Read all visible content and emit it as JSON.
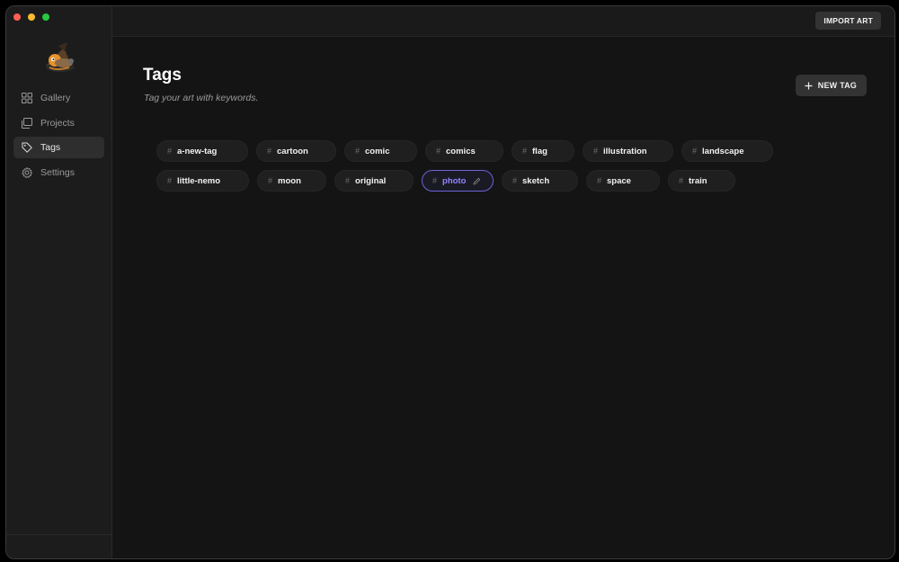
{
  "window": {
    "controls": [
      "close",
      "minimize",
      "zoom"
    ]
  },
  "sidebar": {
    "logo_icon": "wizard-creature-icon",
    "items": [
      {
        "label": "Gallery",
        "icon": "grid-icon",
        "active": false
      },
      {
        "label": "Projects",
        "icon": "folders-icon",
        "active": false
      },
      {
        "label": "Tags",
        "icon": "tag-icon",
        "active": true
      },
      {
        "label": "Settings",
        "icon": "gear-icon",
        "active": false
      }
    ]
  },
  "topbar": {
    "import_label": "IMPORT ART"
  },
  "page": {
    "title": "Tags",
    "subtitle": "Tag your art with keywords.",
    "new_tag_label": "NEW TAG"
  },
  "tags": {
    "hash": "#",
    "rows": [
      [
        {
          "label": "a-new-tag"
        },
        {
          "label": "cartoon"
        },
        {
          "label": "comic"
        },
        {
          "label": "comics"
        },
        {
          "label": "flag"
        },
        {
          "label": "illustration"
        },
        {
          "label": "landscape"
        }
      ],
      [
        {
          "label": "little-nemo"
        },
        {
          "label": "moon"
        },
        {
          "label": "original"
        },
        {
          "label": "photo",
          "selected": true
        },
        {
          "label": "sketch"
        },
        {
          "label": "space"
        },
        {
          "label": "train"
        }
      ]
    ]
  },
  "colors": {
    "accent": "#6d62d8",
    "accent_text": "#8f85ff",
    "background": "#141414",
    "sidebar": "#1c1c1c"
  }
}
